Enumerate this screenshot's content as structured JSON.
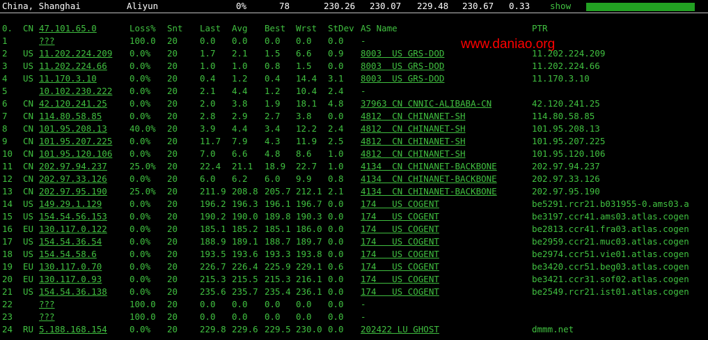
{
  "status": {
    "location": "China, Shanghai",
    "provider": "Aliyun",
    "cpu": "0%",
    "count": "78",
    "v1": "230.26",
    "v2": "230.07",
    "v3": "229.48",
    "v4": "230.67",
    "v5": "0.33",
    "show_label": "show",
    "meter_fraction": 1.0
  },
  "watermark": "www.daniao.org",
  "headers": {
    "hop": "0.",
    "cc": "CN",
    "host": "47.101.65.0",
    "loss": "Loss%",
    "snt": "Snt",
    "last": "Last",
    "avg": "Avg",
    "best": "Best",
    "wrst": "Wrst",
    "stdev": "StDev",
    "as": "AS Name",
    "ptr": "PTR"
  },
  "rows": [
    {
      "hop": "1",
      "cc": "",
      "host": "???",
      "loss": "100.0",
      "snt": "20",
      "last": "0.0",
      "avg": "0.0",
      "best": "0.0",
      "wrst": "0.0",
      "stdev": "0.0",
      "as": "-",
      "ptr": ""
    },
    {
      "hop": "2",
      "cc": "US",
      "host": "11.202.224.209",
      "loss": "0.0%",
      "snt": "20",
      "last": "1.7",
      "avg": "2.1",
      "best": "1.5",
      "wrst": "6.6",
      "stdev": "0.9",
      "as": "8003  US GRS-DOD",
      "ptr": "11.202.224.209"
    },
    {
      "hop": "3",
      "cc": "US",
      "host": "11.202.224.66",
      "loss": "0.0%",
      "snt": "20",
      "last": "1.0",
      "avg": "1.0",
      "best": "0.8",
      "wrst": "1.5",
      "stdev": "0.0",
      "as": "8003  US GRS-DOD",
      "ptr": "11.202.224.66"
    },
    {
      "hop": "4",
      "cc": "US",
      "host": "11.170.3.10",
      "loss": "0.0%",
      "snt": "20",
      "last": "0.4",
      "avg": "1.2",
      "best": "0.4",
      "wrst": "14.4",
      "stdev": "3.1",
      "as": "8003  US GRS-DOD",
      "ptr": "11.170.3.10"
    },
    {
      "hop": "5",
      "cc": "",
      "host": "10.102.230.222",
      "loss": "0.0%",
      "snt": "20",
      "last": "2.1",
      "avg": "4.4",
      "best": "1.2",
      "wrst": "10.4",
      "stdev": "2.4",
      "as": "-",
      "ptr": ""
    },
    {
      "hop": "6",
      "cc": "CN",
      "host": "42.120.241.25",
      "loss": "0.0%",
      "snt": "20",
      "last": "2.0",
      "avg": "3.8",
      "best": "1.9",
      "wrst": "18.1",
      "stdev": "4.8",
      "as": "37963 CN CNNIC-ALIBABA-CN",
      "ptr": "42.120.241.25"
    },
    {
      "hop": "7",
      "cc": "CN",
      "host": "114.80.58.85",
      "loss": "0.0%",
      "snt": "20",
      "last": "2.8",
      "avg": "2.9",
      "best": "2.7",
      "wrst": "3.8",
      "stdev": "0.0",
      "as": "4812  CN CHINANET-SH",
      "ptr": "114.80.58.85"
    },
    {
      "hop": "8",
      "cc": "CN",
      "host": "101.95.208.13",
      "loss": "40.0%",
      "snt": "20",
      "last": "3.9",
      "avg": "4.4",
      "best": "3.4",
      "wrst": "12.2",
      "stdev": "2.4",
      "as": "4812  CN CHINANET-SH",
      "ptr": "101.95.208.13"
    },
    {
      "hop": "9",
      "cc": "CN",
      "host": "101.95.207.225",
      "loss": "0.0%",
      "snt": "20",
      "last": "11.7",
      "avg": "7.9",
      "best": "4.3",
      "wrst": "11.9",
      "stdev": "2.5",
      "as": "4812  CN CHINANET-SH",
      "ptr": "101.95.207.225"
    },
    {
      "hop": "10",
      "cc": "CN",
      "host": "101.95.120.106",
      "loss": "0.0%",
      "snt": "20",
      "last": "7.0",
      "avg": "6.6",
      "best": "4.8",
      "wrst": "8.6",
      "stdev": "1.0",
      "as": "4812  CN CHINANET-SH",
      "ptr": "101.95.120.106"
    },
    {
      "hop": "11",
      "cc": "CN",
      "host": "202.97.94.237",
      "loss": "25.0%",
      "snt": "20",
      "last": "22.4",
      "avg": "21.1",
      "best": "18.9",
      "wrst": "22.7",
      "stdev": "1.0",
      "as": "4134  CN CHINANET-BACKBONE",
      "ptr": "202.97.94.237"
    },
    {
      "hop": "12",
      "cc": "CN",
      "host": "202.97.33.126",
      "loss": "0.0%",
      "snt": "20",
      "last": "6.0",
      "avg": "6.2",
      "best": "6.0",
      "wrst": "9.9",
      "stdev": "0.8",
      "as": "4134  CN CHINANET-BACKBONE",
      "ptr": "202.97.33.126"
    },
    {
      "hop": "13",
      "cc": "CN",
      "host": "202.97.95.190",
      "loss": "25.0%",
      "snt": "20",
      "last": "211.9",
      "avg": "208.8",
      "best": "205.7",
      "wrst": "212.1",
      "stdev": "2.1",
      "as": "4134  CN CHINANET-BACKBONE",
      "ptr": "202.97.95.190"
    },
    {
      "hop": "14",
      "cc": "US",
      "host": "149.29.1.129",
      "loss": "0.0%",
      "snt": "20",
      "last": "196.2",
      "avg": "196.3",
      "best": "196.1",
      "wrst": "196.7",
      "stdev": "0.0",
      "as": "174   US COGENT",
      "ptr": "be5291.rcr21.b031955-0.ams03.a"
    },
    {
      "hop": "15",
      "cc": "US",
      "host": "154.54.56.153",
      "loss": "0.0%",
      "snt": "20",
      "last": "190.2",
      "avg": "190.0",
      "best": "189.8",
      "wrst": "190.3",
      "stdev": "0.0",
      "as": "174   US COGENT",
      "ptr": "be3197.ccr41.ams03.atlas.cogen"
    },
    {
      "hop": "16",
      "cc": "EU",
      "host": "130.117.0.122",
      "loss": "0.0%",
      "snt": "20",
      "last": "185.1",
      "avg": "185.2",
      "best": "185.1",
      "wrst": "186.0",
      "stdev": "0.0",
      "as": "174   US COGENT",
      "ptr": "be2813.ccr41.fra03.atlas.cogen"
    },
    {
      "hop": "17",
      "cc": "US",
      "host": "154.54.36.54",
      "loss": "0.0%",
      "snt": "20",
      "last": "188.9",
      "avg": "189.1",
      "best": "188.7",
      "wrst": "189.7",
      "stdev": "0.0",
      "as": "174   US COGENT",
      "ptr": "be2959.ccr21.muc03.atlas.cogen"
    },
    {
      "hop": "18",
      "cc": "US",
      "host": "154.54.58.6",
      "loss": "0.0%",
      "snt": "20",
      "last": "193.5",
      "avg": "193.6",
      "best": "193.3",
      "wrst": "193.8",
      "stdev": "0.0",
      "as": "174   US COGENT",
      "ptr": "be2974.ccr51.vie01.atlas.cogen"
    },
    {
      "hop": "19",
      "cc": "EU",
      "host": "130.117.0.70",
      "loss": "0.0%",
      "snt": "20",
      "last": "226.7",
      "avg": "226.4",
      "best": "225.9",
      "wrst": "229.1",
      "stdev": "0.6",
      "as": "174   US COGENT",
      "ptr": "be3420.ccr51.beg03.atlas.cogen"
    },
    {
      "hop": "20",
      "cc": "EU",
      "host": "130.117.0.93",
      "loss": "0.0%",
      "snt": "20",
      "last": "215.3",
      "avg": "215.5",
      "best": "215.3",
      "wrst": "216.1",
      "stdev": "0.0",
      "as": "174   US COGENT",
      "ptr": "be3421.ccr31.sof02.atlas.cogen"
    },
    {
      "hop": "21",
      "cc": "US",
      "host": "154.54.36.138",
      "loss": "0.0%",
      "snt": "20",
      "last": "235.6",
      "avg": "235.7",
      "best": "235.4",
      "wrst": "236.1",
      "stdev": "0.0",
      "as": "174   US COGENT",
      "ptr": "be2549.rcr21.ist01.atlas.cogen"
    },
    {
      "hop": "22",
      "cc": "",
      "host": "???",
      "loss": "100.0",
      "snt": "20",
      "last": "0.0",
      "avg": "0.0",
      "best": "0.0",
      "wrst": "0.0",
      "stdev": "0.0",
      "as": "-",
      "ptr": ""
    },
    {
      "hop": "23",
      "cc": "",
      "host": "???",
      "loss": "100.0",
      "snt": "20",
      "last": "0.0",
      "avg": "0.0",
      "best": "0.0",
      "wrst": "0.0",
      "stdev": "0.0",
      "as": "-",
      "ptr": ""
    },
    {
      "hop": "24",
      "cc": "RU",
      "host": "5.188.168.154",
      "loss": "0.0%",
      "snt": "20",
      "last": "229.8",
      "avg": "229.6",
      "best": "229.5",
      "wrst": "230.0",
      "stdev": "0.0",
      "as": "202422 LU GHOST",
      "ptr": "dmmm.net"
    }
  ],
  "colors": {
    "background": "#000000",
    "text_green": "#40c040",
    "header_white": "#ffffff",
    "watermark_red": "#ff0000",
    "meter_green": "#22a022"
  }
}
